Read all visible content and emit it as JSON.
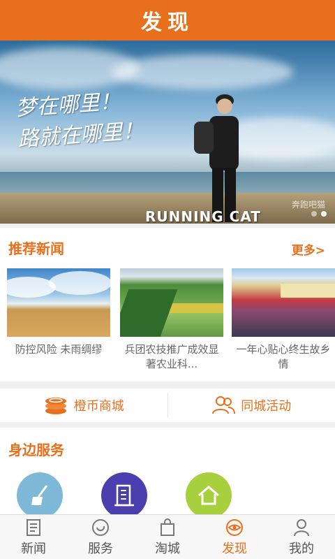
{
  "header": {
    "title": "发现"
  },
  "banner": {
    "slogan_line1": "梦在哪里！",
    "slogan_line2": "路就在哪里！",
    "caption": "RUNNING CAT",
    "watermark": "奔跑吧猫",
    "slide_count": 2,
    "active_slide": 2
  },
  "news": {
    "title": "推荐新闻",
    "more_label": "更多>",
    "items": [
      {
        "text": "防控风险 未雨绸缪"
      },
      {
        "text": "兵团农技推广成效显著农业科..."
      },
      {
        "text": "一年心贴心终生故乡情"
      }
    ]
  },
  "quick_links": {
    "coin_mall": "橙币商城",
    "city_events": "同城活动"
  },
  "services": {
    "title": "身边服务",
    "icons": [
      "broom-icon",
      "building-icon",
      "house-icon"
    ],
    "colors": [
      "#7fb9d8",
      "#4b3fb0",
      "#a8cf3e"
    ]
  },
  "tabbar": {
    "tabs": [
      {
        "label": "新闻",
        "icon": "newspaper-icon"
      },
      {
        "label": "服务",
        "icon": "service-icon"
      },
      {
        "label": "淘城",
        "icon": "shopping-bag-icon"
      },
      {
        "label": "发现",
        "icon": "eye-icon",
        "active": true
      },
      {
        "label": "我的",
        "icon": "user-icon"
      }
    ]
  },
  "colors": {
    "accent": "#e8701c"
  }
}
